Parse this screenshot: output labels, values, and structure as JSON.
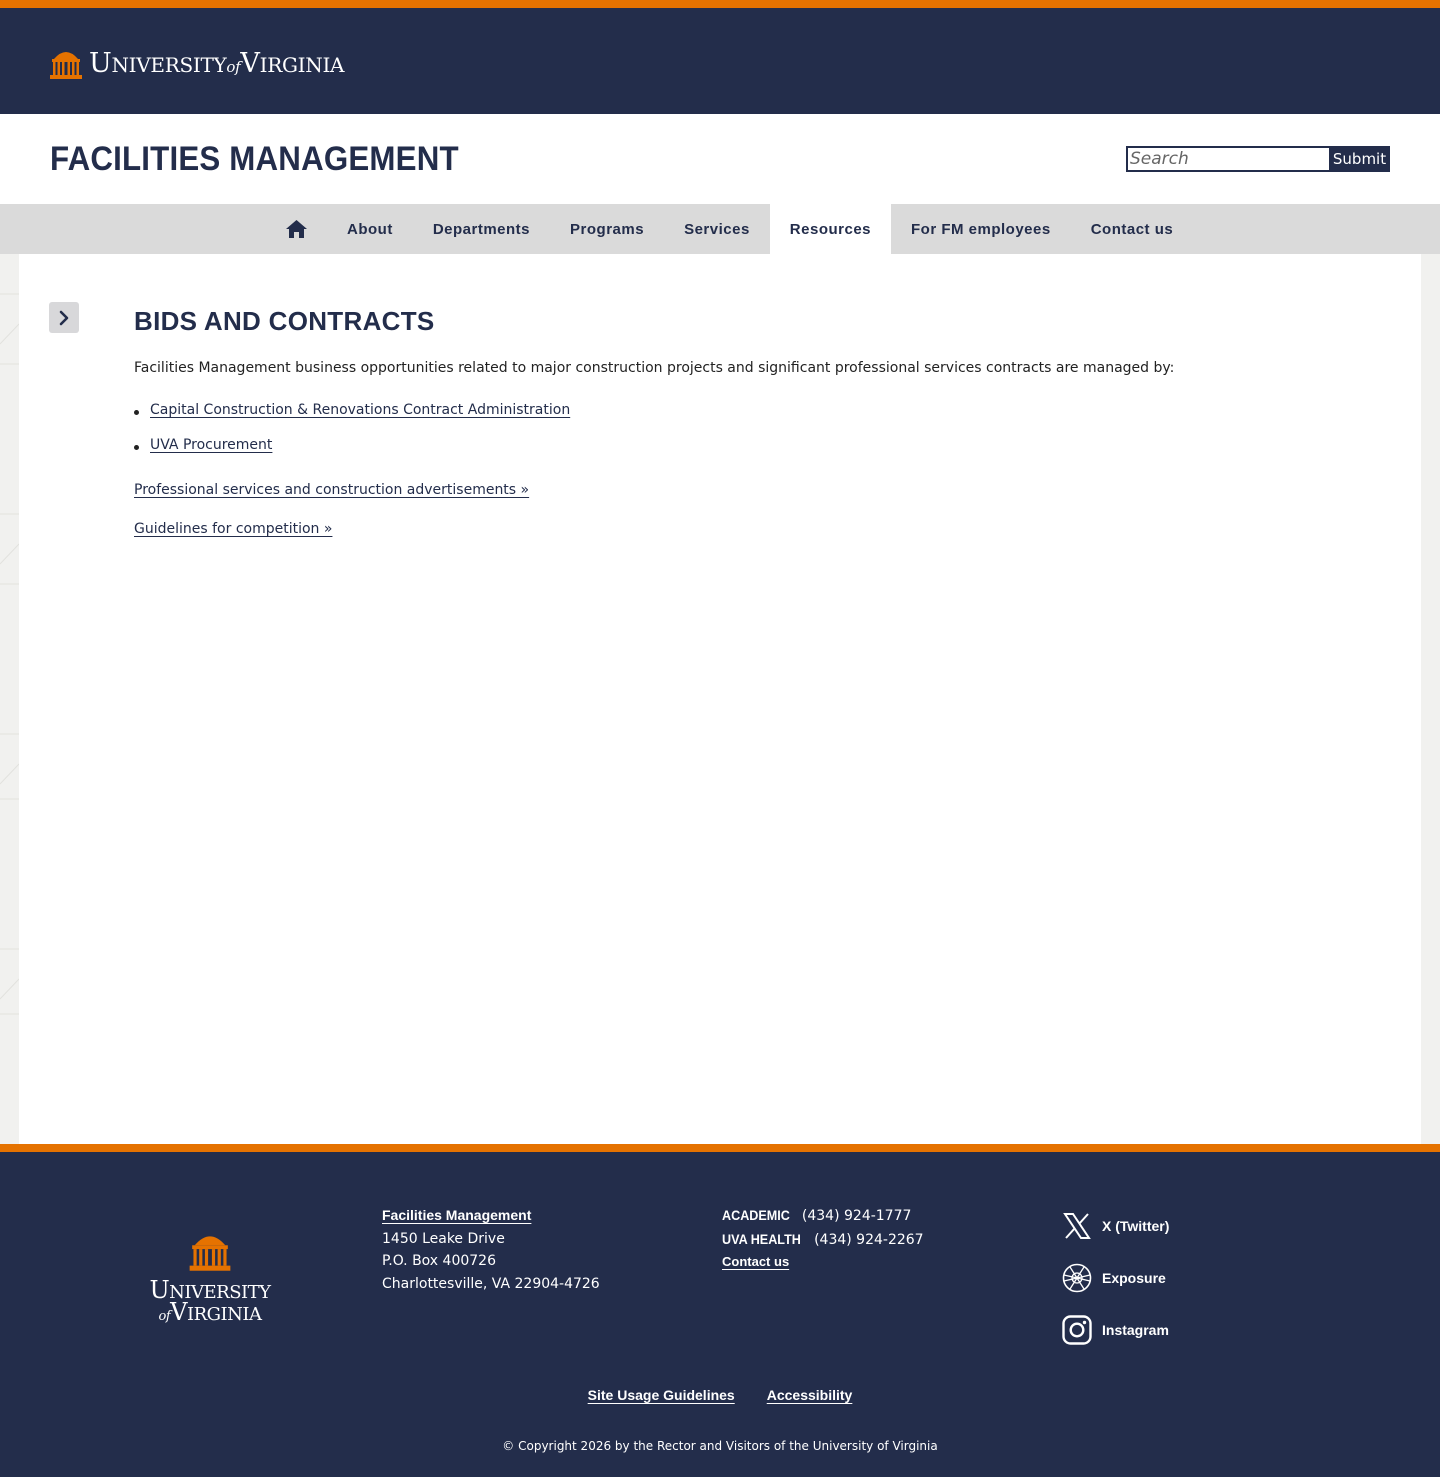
{
  "brand": {
    "uni_big_1": "U",
    "uni_small_1": "NIVERSITY",
    "of": "of",
    "uni_big_2": "V",
    "uni_small_2": "IRGINIA"
  },
  "header": {
    "site_title": "FACILITIES MANAGEMENT",
    "search_placeholder": "Search",
    "submit_label": "Submit"
  },
  "nav": {
    "home_icon": "home-icon",
    "items": [
      "About",
      "Departments",
      "Programs",
      "Services",
      "Resources",
      "For FM employees",
      "Contact us"
    ],
    "active": "Resources"
  },
  "main": {
    "title": "BIDS AND CONTRACTS",
    "intro": "Facilities Management business opportunities related to major construction projects and significant professional services contracts are managed by:",
    "list": [
      "Capital Construction & Renovations Contract Administration",
      "UVA Procurement"
    ],
    "link1": "Professional services and construction advertisements »",
    "link2": "Guidelines for competition »"
  },
  "footer": {
    "logo_big_1": "U",
    "logo_small_1": "NIVERSITY",
    "logo_of": "of",
    "logo_big_2": "V",
    "logo_small_2": "IRGINIA",
    "org": "Facilities Management",
    "address": [
      "1450 Leake Drive",
      "P.O. Box 400726",
      "Charlottesville, VA 22904-4726"
    ],
    "academic_label": "ACADEMIC",
    "academic_phone": "(434) 924-1777",
    "health_label": "UVA HEALTH",
    "health_phone": "(434) 924-2267",
    "contact": "Contact us",
    "socials": [
      "X (Twitter)",
      "Exposure",
      "Instagram"
    ],
    "links": [
      "Site Usage Guidelines",
      "Accessibility"
    ],
    "copyright": "© Copyright 2026 by the Rector and Visitors of the University of Virginia"
  },
  "colors": {
    "navy": "#232D4B",
    "orange": "#E57200",
    "nav_gray": "#DADADA"
  }
}
